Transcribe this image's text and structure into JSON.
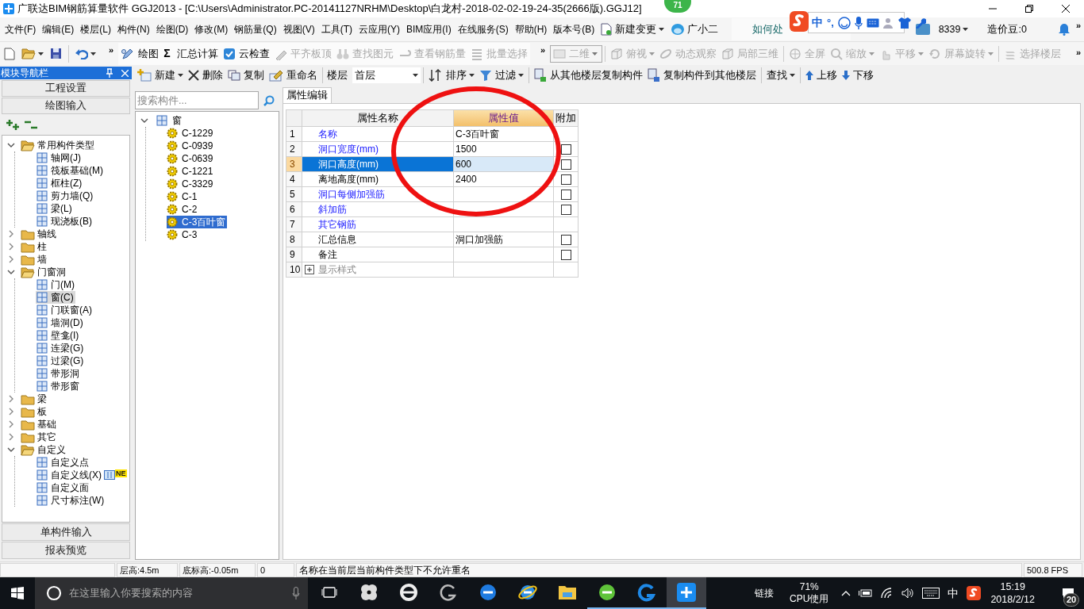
{
  "window": {
    "title": "广联达BIM钢筋算量软件 GGJ2013 - [C:\\Users\\Administrator.PC-20141127NRHM\\Desktop\\白龙村-2018-02-02-19-24-35(2666版).GGJ12]",
    "badge": "71"
  },
  "menu": {
    "items": [
      "文件(F)",
      "编辑(E)",
      "楼层(L)",
      "构件(N)",
      "绘图(D)",
      "修改(M)",
      "钢筋量(Q)",
      "视图(V)",
      "工具(T)",
      "云应用(Y)",
      "BIM应用(I)",
      "在线服务(S)",
      "帮助(H)",
      "版本号(B)"
    ],
    "change": "新建变更",
    "assistant": "广小二",
    "news": "如何处",
    "account": "8339",
    "beans": "造价豆:0",
    "more": "»"
  },
  "ime": {
    "items": [
      "中",
      "°,"
    ]
  },
  "toolbar": {
    "more": "»",
    "left": [
      [
        {
          "label": "绘图",
          "disabled": false
        },
        {
          "label": "汇总计算",
          "symbol": "Σ",
          "disabled": false
        },
        {
          "label": "云检查",
          "disabled": false
        },
        {
          "label": "平齐板顶",
          "disabled": true
        },
        {
          "label": "查找图元",
          "disabled": true
        },
        {
          "label": "查看钢筋量",
          "disabled": true
        },
        {
          "label": "批量选择",
          "disabled": true
        }
      ]
    ],
    "right_more": "»",
    "right": [
      [
        {
          "label": "二维",
          "kind": "select",
          "dropdown": true,
          "disabled": true
        }
      ],
      [
        {
          "label": "俯视",
          "kind": "button",
          "dropdown": true,
          "disabled": true
        },
        {
          "label": "动态观察",
          "kind": "button",
          "dropdown": false,
          "disabled": true
        },
        {
          "label": "局部三维",
          "kind": "button",
          "dropdown": false,
          "disabled": true
        }
      ],
      [
        {
          "label": "全屏",
          "kind": "button",
          "dropdown": false,
          "disabled": true
        },
        {
          "label": "缩放",
          "kind": "button",
          "dropdown": true,
          "disabled": true
        },
        {
          "label": "平移",
          "kind": "button",
          "dropdown": true,
          "disabled": true
        },
        {
          "label": "屏幕旋转",
          "kind": "button",
          "dropdown": true,
          "disabled": true
        }
      ],
      [
        {
          "label": "选择楼层",
          "kind": "button",
          "dropdown": false,
          "disabled": true
        }
      ]
    ],
    "end_more": "»"
  },
  "navigator": {
    "title": "模块导航栏",
    "top": [
      "工程设置",
      "绘图输入"
    ],
    "bottom": [
      "单构件输入",
      "报表预览"
    ],
    "tree": [
      {
        "label": "常用构件类型",
        "expanded": true,
        "selected": false,
        "children": [
          {
            "label": "轴网(J)",
            "selected": false
          },
          {
            "label": "筏板基础(M)",
            "selected": false
          },
          {
            "label": "框柱(Z)",
            "selected": false
          },
          {
            "label": "剪力墙(Q)",
            "selected": false
          },
          {
            "label": "梁(L)",
            "selected": false
          },
          {
            "label": "现浇板(B)",
            "selected": false
          }
        ]
      },
      {
        "label": "轴线",
        "expanded": false,
        "selected": false
      },
      {
        "label": "柱",
        "expanded": false,
        "selected": false
      },
      {
        "label": "墙",
        "expanded": false,
        "selected": false
      },
      {
        "label": "门窗洞",
        "expanded": true,
        "selected": false,
        "children": [
          {
            "label": "门(M)",
            "selected": false
          },
          {
            "label": "窗(C)",
            "selected": true
          },
          {
            "label": "门联窗(A)",
            "selected": false
          },
          {
            "label": "墙洞(D)",
            "selected": false
          },
          {
            "label": "壁龛(I)",
            "selected": false
          },
          {
            "label": "连梁(G)",
            "selected": false
          },
          {
            "label": "过梁(G)",
            "selected": false
          },
          {
            "label": "带形洞",
            "selected": false
          },
          {
            "label": "带形窗",
            "selected": false
          }
        ]
      },
      {
        "label": "梁",
        "expanded": false,
        "selected": false
      },
      {
        "label": "板",
        "expanded": false,
        "selected": false
      },
      {
        "label": "基础",
        "expanded": false,
        "selected": false
      },
      {
        "label": "其它",
        "expanded": false,
        "selected": false
      },
      {
        "label": "自定义",
        "expanded": true,
        "selected": false,
        "children": [
          {
            "label": "自定义点",
            "selected": false
          },
          {
            "label": "自定义线(X)",
            "selected": false,
            "badge": "NE"
          },
          {
            "label": "自定义面",
            "selected": false
          },
          {
            "label": "尺寸标注(W)",
            "selected": false
          }
        ]
      }
    ]
  },
  "component_toolbar": {
    "groups": [
      [
        {
          "kind": "button",
          "label": "新建",
          "dropdown": true
        },
        {
          "kind": "button",
          "label": "删除",
          "dropdown": false
        },
        {
          "kind": "button",
          "label": "复制",
          "dropdown": false
        },
        {
          "kind": "button",
          "label": "重命名",
          "dropdown": false
        }
      ],
      [
        {
          "kind": "floor",
          "label": "楼层",
          "value": "首层"
        }
      ],
      [
        {
          "kind": "button",
          "label": "排序",
          "dropdown": true
        },
        {
          "kind": "button",
          "label": "过滤",
          "dropdown": true
        }
      ],
      [
        {
          "kind": "button",
          "label": "从其他楼层复制构件",
          "dropdown": false
        },
        {
          "kind": "button",
          "label": "复制构件到其他楼层",
          "dropdown": false
        }
      ],
      [
        {
          "kind": "button",
          "label": "查找",
          "dropdown": true
        }
      ],
      [
        {
          "kind": "button",
          "label": "上移",
          "dropdown": false
        },
        {
          "kind": "button",
          "label": "下移",
          "dropdown": false
        }
      ]
    ]
  },
  "components": {
    "search": {
      "placeholder": "搜索构件..."
    },
    "tree": [
      {
        "label": "窗",
        "expanded": true,
        "selected": false,
        "children": [
          {
            "label": "C-1229",
            "selected": false
          },
          {
            "label": "C-0939",
            "selected": false
          },
          {
            "label": "C-0639",
            "selected": false
          },
          {
            "label": "C-1221",
            "selected": false
          },
          {
            "label": "C-3329",
            "selected": false
          },
          {
            "label": "C-1",
            "selected": false
          },
          {
            "label": "C-2",
            "selected": false
          },
          {
            "label": "C-3百叶窗",
            "selected": true
          },
          {
            "label": "C-3",
            "selected": false
          }
        ]
      }
    ]
  },
  "properties": {
    "tab": "属性编辑",
    "columns": [
      {
        "label": "属性名称",
        "selected": false
      },
      {
        "label": "属性值",
        "selected": true
      },
      {
        "label": "附加",
        "selected": false
      }
    ],
    "rows": [
      {
        "index": "1",
        "name": "名称",
        "kind": "link",
        "value": "C-3百叶窗",
        "selected": false
      },
      {
        "index": "2",
        "name": "洞口宽度(mm)",
        "kind": "link",
        "value": "1500",
        "selected": false,
        "checked": false
      },
      {
        "index": "3",
        "name": "洞口高度(mm)",
        "kind": "link",
        "value": "600",
        "selected": true,
        "checked": false
      },
      {
        "index": "4",
        "name": "离地高度(mm)",
        "kind": "text",
        "value": "2400",
        "selected": false,
        "checked": false
      },
      {
        "index": "5",
        "name": "洞口每侧加强筋",
        "kind": "link",
        "selected": false,
        "checked": false
      },
      {
        "index": "6",
        "name": "斜加筋",
        "kind": "link",
        "selected": false,
        "checked": false
      },
      {
        "index": "7",
        "name": "其它钢筋",
        "kind": "link",
        "selected": false
      },
      {
        "index": "8",
        "name": "汇总信息",
        "kind": "text",
        "value": "洞口加强筋",
        "selected": false,
        "checked": false
      },
      {
        "index": "9",
        "name": "备注",
        "kind": "text",
        "selected": false,
        "checked": false
      },
      {
        "index": "10",
        "name": "显示样式",
        "kind": "group",
        "expanded": false,
        "selected": false
      }
    ],
    "annotation": {
      "kind": "ellipse"
    }
  },
  "status_bar": {
    "floor_height": "层高:4.5m",
    "base_elevation": "底标高:-0.05m",
    "count": "0",
    "message": "名称在当前层当前构件类型下不允许重名",
    "fps": "500.8 FPS"
  },
  "taskbar": {
    "search_placeholder": "在这里输入你要搜索的内容",
    "apps": [
      {
        "open": false,
        "selected": false
      },
      {
        "open": false,
        "selected": false
      },
      {
        "open": false,
        "selected": false
      },
      {
        "open": false,
        "selected": false
      },
      {
        "open": false,
        "selected": false
      },
      {
        "open": false,
        "selected": false
      },
      {
        "open": false,
        "selected": false
      },
      {
        "open": true,
        "selected": false
      },
      {
        "open": true,
        "selected": false
      },
      {
        "open": true,
        "selected": true
      }
    ],
    "link": "链接",
    "cpu": "71%",
    "cpu_label": "CPU使用",
    "ime": "中",
    "time": "15:19",
    "date": "2018/2/12",
    "notifications": "20"
  }
}
